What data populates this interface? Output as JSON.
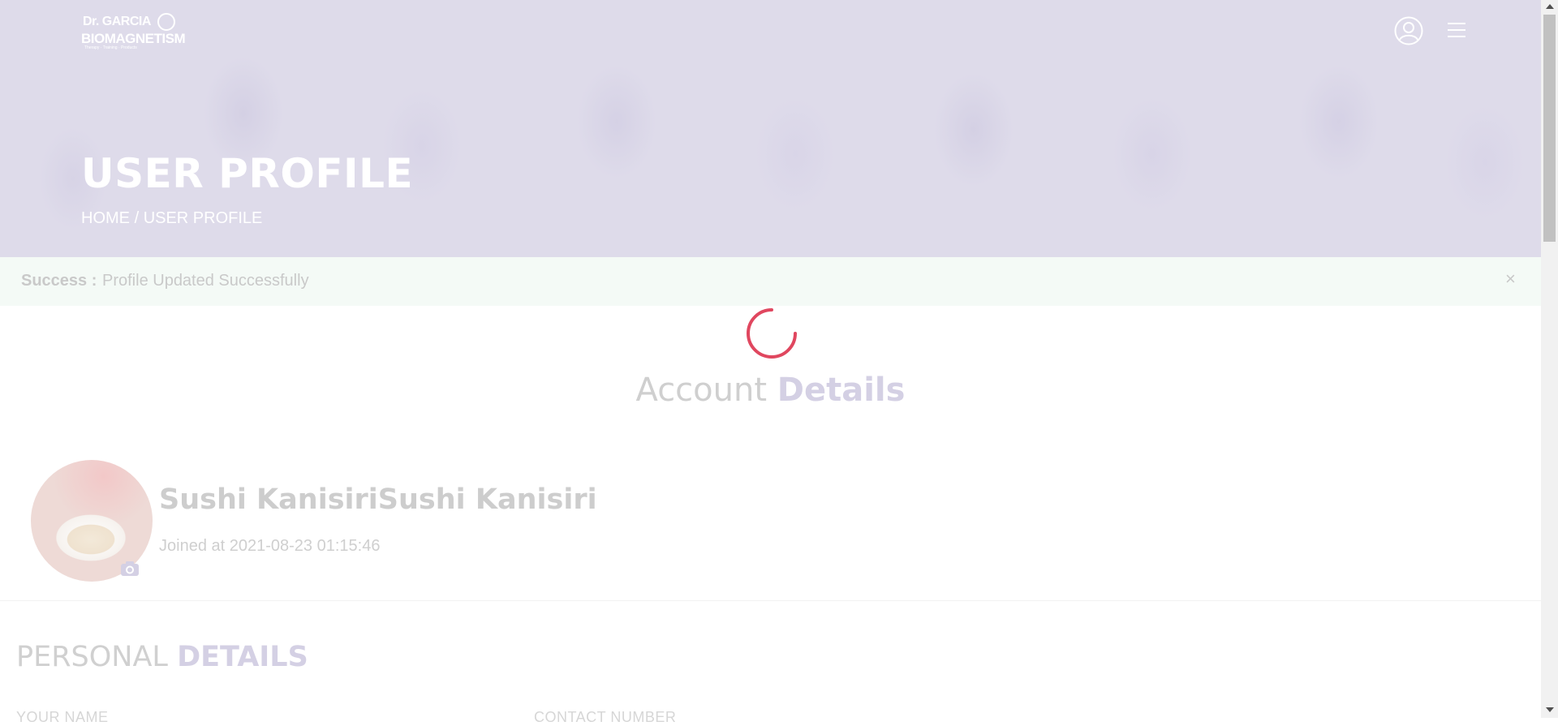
{
  "brand": {
    "line1": "Dr. GARCIA",
    "line2": "BIOMAGNETISM",
    "tagline": "Therapy · Training · Products"
  },
  "header": {
    "title": "USER PROFILE",
    "breadcrumb": {
      "home": "HOME",
      "separator": "/",
      "current": "USER PROFILE"
    }
  },
  "alert": {
    "label": "Success :",
    "message": "Profile Updated Successfully",
    "close": "×"
  },
  "account": {
    "title_light": "Account",
    "title_bold": "Details",
    "user_name": "Sushi KanisiriSushi Kanisiri",
    "joined": "Joined at 2021-08-23 01:15:46"
  },
  "personal": {
    "title_light": "PERSONAL",
    "title_bold": "DETAILS",
    "fields": [
      {
        "label": "YOUR NAME"
      },
      {
        "label": "CONTACT NUMBER"
      }
    ]
  },
  "colors": {
    "spinner": "#e0475f",
    "accent_muted": "#d4d0e4",
    "alert_bg": "#f4faf6"
  },
  "icons": {
    "user": "user-circle-icon",
    "menu": "hamburger-menu-icon",
    "camera": "camera-icon",
    "close": "close-icon",
    "spinner": "loading-spinner-icon"
  }
}
